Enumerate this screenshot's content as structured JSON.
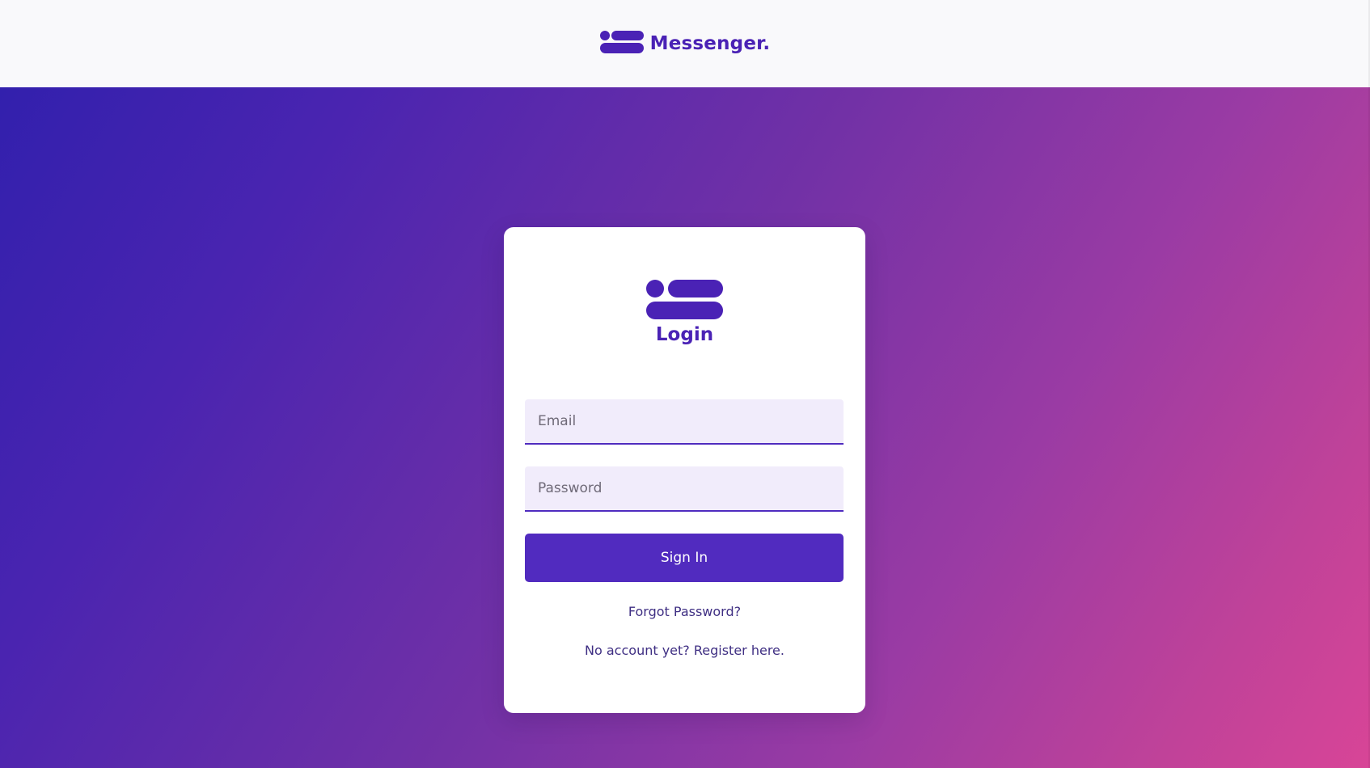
{
  "header": {
    "brand_name": "Messenger.",
    "logo_icon": "messenger-logo-icon",
    "brand_color": "#4a22b5"
  },
  "login": {
    "title": "Login",
    "logo_icon": "messenger-logo-icon",
    "email_placeholder": "Email",
    "password_placeholder": "Password",
    "submit_label": "Sign In",
    "forgot_link": "Forgot Password?",
    "register_link": "No account yet? Register here."
  },
  "colors": {
    "accent": "#512bbf",
    "input_bg": "#f1ecfb",
    "gradient_start": "#3220ad",
    "gradient_end": "#d84597"
  }
}
